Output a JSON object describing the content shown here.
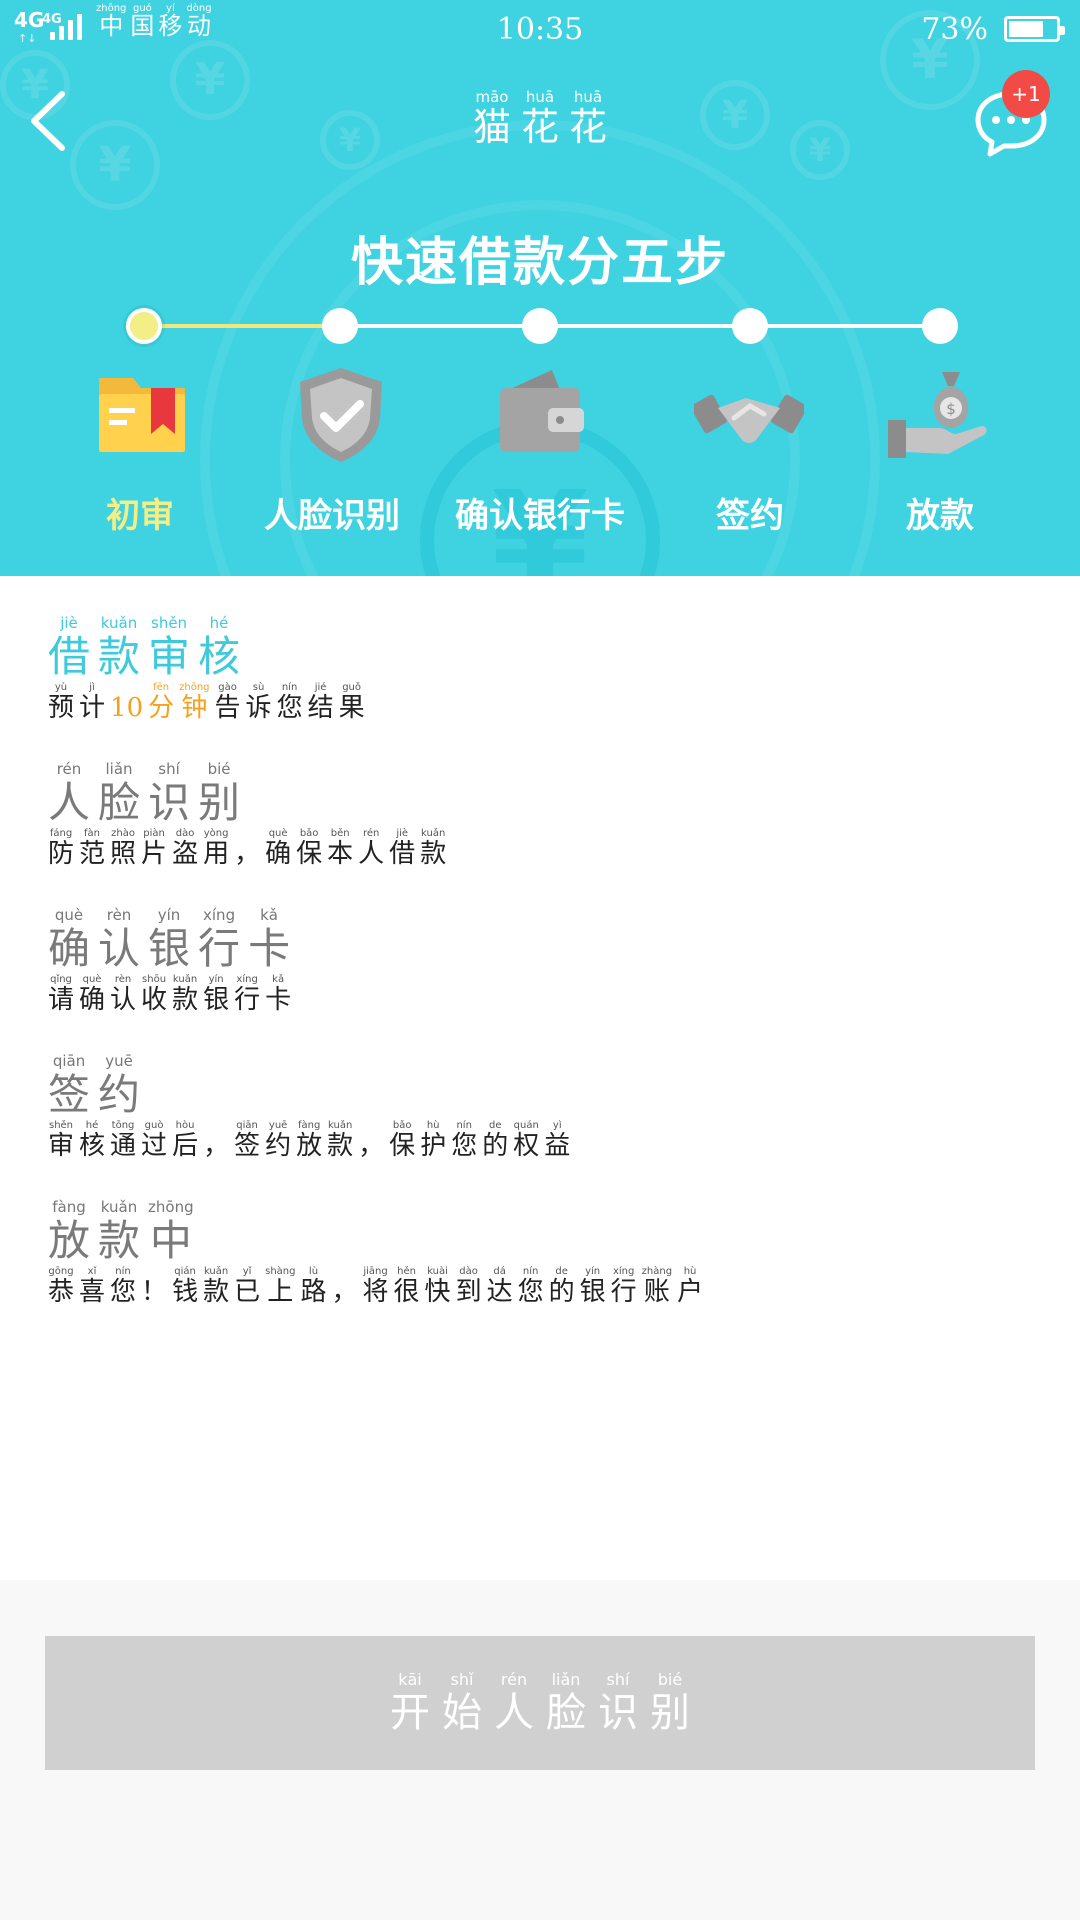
{
  "status_bar": {
    "network": "4G",
    "network_secondary": "4G",
    "carrier": [
      {
        "py": "zhōng",
        "hz": "中"
      },
      {
        "py": "guó",
        "hz": "国"
      },
      {
        "py": "yí",
        "hz": "移"
      },
      {
        "py": "dòng",
        "hz": "动"
      }
    ],
    "time": "10:35",
    "battery_percent": "73%",
    "battery_level": 0.73
  },
  "header": {
    "title": [
      {
        "py": "māo",
        "hz": "猫"
      },
      {
        "py": "huā",
        "hz": "花"
      },
      {
        "py": "huā",
        "hz": "花"
      }
    ],
    "message_badge": "+1",
    "heading": "快速借款分五步",
    "steps": [
      {
        "label": "初审",
        "icon": "folder-bookmark-icon",
        "active": true
      },
      {
        "label": "人脸识别",
        "icon": "shield-check-icon",
        "active": false
      },
      {
        "label": "确认银行卡",
        "icon": "wallet-icon",
        "active": false
      },
      {
        "label": "签约",
        "icon": "handshake-icon",
        "active": false
      },
      {
        "label": "放款",
        "icon": "money-bag-hand-icon",
        "active": false
      }
    ],
    "colors": {
      "background": "#3fd2e0",
      "active": "#f3ee86"
    }
  },
  "process": [
    {
      "active": true,
      "title": [
        {
          "py": "jiè",
          "hz": "借"
        },
        {
          "py": "kuǎn",
          "hz": "款"
        },
        {
          "py": "shěn",
          "hz": "审"
        },
        {
          "py": "hé",
          "hz": "核"
        }
      ],
      "desc": [
        {
          "py": "yù",
          "hz": "预"
        },
        {
          "py": "jì",
          "hz": "计"
        },
        {
          "py": "",
          "hz": "10",
          "hl": true
        },
        {
          "py": "fēn",
          "hz": "分",
          "hl": true
        },
        {
          "py": "zhōng",
          "hz": "钟",
          "hl": true
        },
        {
          "py": "gào",
          "hz": "告"
        },
        {
          "py": "sù",
          "hz": "诉"
        },
        {
          "py": "nín",
          "hz": "您"
        },
        {
          "py": "jié",
          "hz": "结"
        },
        {
          "py": "guǒ",
          "hz": "果"
        }
      ]
    },
    {
      "active": false,
      "title": [
        {
          "py": "rén",
          "hz": "人"
        },
        {
          "py": "liǎn",
          "hz": "脸"
        },
        {
          "py": "shí",
          "hz": "识"
        },
        {
          "py": "bié",
          "hz": "别"
        }
      ],
      "desc": [
        {
          "py": "fáng",
          "hz": "防"
        },
        {
          "py": "fàn",
          "hz": "范"
        },
        {
          "py": "zhào",
          "hz": "照"
        },
        {
          "py": "piàn",
          "hz": "片"
        },
        {
          "py": "dào",
          "hz": "盗"
        },
        {
          "py": "yòng",
          "hz": "用"
        },
        {
          "py": "",
          "hz": "，"
        },
        {
          "py": "què",
          "hz": "确"
        },
        {
          "py": "bǎo",
          "hz": "保"
        },
        {
          "py": "běn",
          "hz": "本"
        },
        {
          "py": "rén",
          "hz": "人"
        },
        {
          "py": "jiè",
          "hz": "借"
        },
        {
          "py": "kuǎn",
          "hz": "款"
        }
      ]
    },
    {
      "active": false,
      "title": [
        {
          "py": "què",
          "hz": "确"
        },
        {
          "py": "rèn",
          "hz": "认"
        },
        {
          "py": "yín",
          "hz": "银"
        },
        {
          "py": "xíng",
          "hz": "行"
        },
        {
          "py": "kǎ",
          "hz": "卡"
        }
      ],
      "desc": [
        {
          "py": "qǐng",
          "hz": "请"
        },
        {
          "py": "què",
          "hz": "确"
        },
        {
          "py": "rèn",
          "hz": "认"
        },
        {
          "py": "shōu",
          "hz": "收"
        },
        {
          "py": "kuǎn",
          "hz": "款"
        },
        {
          "py": "yín",
          "hz": "银"
        },
        {
          "py": "xíng",
          "hz": "行"
        },
        {
          "py": "kǎ",
          "hz": "卡"
        }
      ]
    },
    {
      "active": false,
      "title": [
        {
          "py": "qiān",
          "hz": "签"
        },
        {
          "py": "yuē",
          "hz": "约"
        }
      ],
      "desc": [
        {
          "py": "shěn",
          "hz": "审"
        },
        {
          "py": "hé",
          "hz": "核"
        },
        {
          "py": "tōng",
          "hz": "通"
        },
        {
          "py": "guò",
          "hz": "过"
        },
        {
          "py": "hòu",
          "hz": "后"
        },
        {
          "py": "",
          "hz": "，"
        },
        {
          "py": "qiān",
          "hz": "签"
        },
        {
          "py": "yuē",
          "hz": "约"
        },
        {
          "py": "fàng",
          "hz": "放"
        },
        {
          "py": "kuǎn",
          "hz": "款"
        },
        {
          "py": "",
          "hz": "，"
        },
        {
          "py": "bǎo",
          "hz": "保"
        },
        {
          "py": "hù",
          "hz": "护"
        },
        {
          "py": "nín",
          "hz": "您"
        },
        {
          "py": "de",
          "hz": "的"
        },
        {
          "py": "quán",
          "hz": "权"
        },
        {
          "py": "yì",
          "hz": "益"
        }
      ]
    },
    {
      "active": false,
      "title": [
        {
          "py": "fàng",
          "hz": "放"
        },
        {
          "py": "kuǎn",
          "hz": "款"
        },
        {
          "py": "zhōng",
          "hz": "中"
        }
      ],
      "desc": [
        {
          "py": "gōng",
          "hz": "恭"
        },
        {
          "py": "xǐ",
          "hz": "喜"
        },
        {
          "py": "nín",
          "hz": "您"
        },
        {
          "py": "",
          "hz": "！"
        },
        {
          "py": "qián",
          "hz": "钱"
        },
        {
          "py": "kuǎn",
          "hz": "款"
        },
        {
          "py": "yǐ",
          "hz": "已"
        },
        {
          "py": "shàng",
          "hz": "上"
        },
        {
          "py": "lù",
          "hz": "路"
        },
        {
          "py": "",
          "hz": "，"
        },
        {
          "py": "jiāng",
          "hz": "将"
        },
        {
          "py": "hěn",
          "hz": "很"
        },
        {
          "py": "kuài",
          "hz": "快"
        },
        {
          "py": "dào",
          "hz": "到"
        },
        {
          "py": "dá",
          "hz": "达"
        },
        {
          "py": "nín",
          "hz": "您"
        },
        {
          "py": "de",
          "hz": "的"
        },
        {
          "py": "yín",
          "hz": "银"
        },
        {
          "py": "xíng",
          "hz": "行"
        },
        {
          "py": "zhàng",
          "hz": "账"
        },
        {
          "py": "hù",
          "hz": "户"
        }
      ]
    }
  ],
  "footer": {
    "button": [
      {
        "py": "kāi",
        "hz": "开"
      },
      {
        "py": "shǐ",
        "hz": "始"
      },
      {
        "py": "rén",
        "hz": "人"
      },
      {
        "py": "liǎn",
        "hz": "脸"
      },
      {
        "py": "shí",
        "hz": "识"
      },
      {
        "py": "bié",
        "hz": "别"
      }
    ],
    "button_color": "#d0d0d0"
  }
}
